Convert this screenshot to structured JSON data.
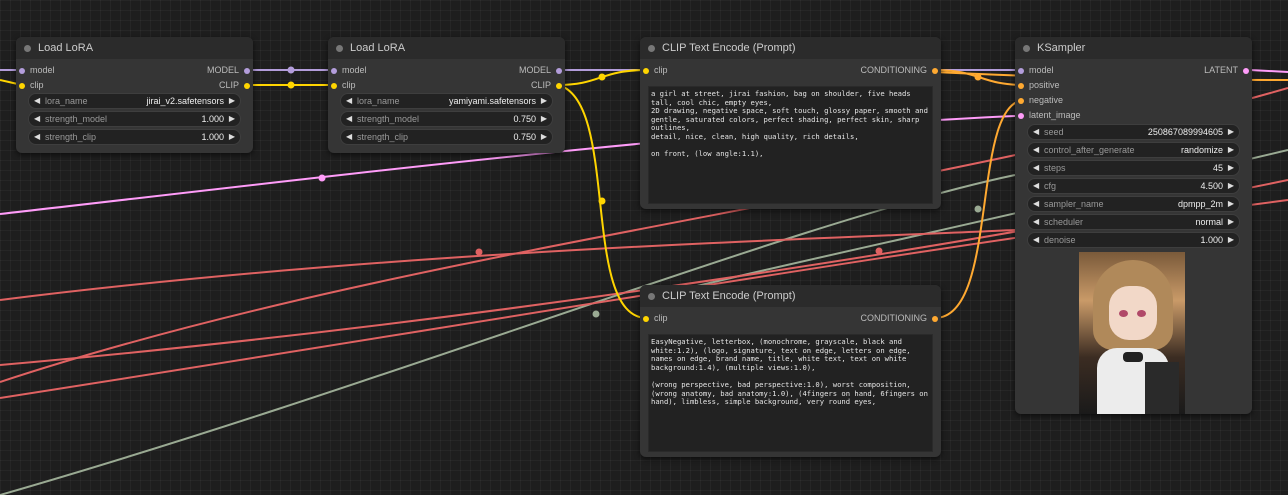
{
  "colors": {
    "model": "#b39ddb",
    "clip": "#ffd500",
    "conditioning": "#ffa931",
    "latent": "#ff9cf9",
    "red": "#e06262",
    "gray": "#9aaa93"
  },
  "nodes": {
    "lora1": {
      "title": "Load LoRA",
      "in_model": "model",
      "in_clip": "clip",
      "out_model": "MODEL",
      "out_clip": "CLIP",
      "w1_label": "lora_name",
      "w1_value": "jirai_v2.safetensors",
      "w2_label": "strength_model",
      "w2_value": "1.000",
      "w3_label": "strength_clip",
      "w3_value": "1.000"
    },
    "lora2": {
      "title": "Load LoRA",
      "in_model": "model",
      "in_clip": "clip",
      "out_model": "MODEL",
      "out_clip": "CLIP",
      "w1_label": "lora_name",
      "w1_value": "yamiyami.safetensors",
      "w2_label": "strength_model",
      "w2_value": "0.750",
      "w3_label": "strength_clip",
      "w3_value": "0.750"
    },
    "clip_pos": {
      "title": "CLIP Text Encode (Prompt)",
      "in_clip": "clip",
      "out": "CONDITIONING",
      "text": "a girl at street, jirai fashion, bag on shoulder, five heads tall, cool chic, empty eyes,\n2D drawing, negative space, soft touch, glossy paper, smooth and gentle, saturated colors, perfect shading, perfect skin, sharp outlines,\ndetail, nice, clean, high quality, rich details,\n\non front, (low angle:1.1),"
    },
    "clip_neg": {
      "title": "CLIP Text Encode (Prompt)",
      "in_clip": "clip",
      "out": "CONDITIONING",
      "text": "EasyNegative, letterbox, (monochrome, grayscale, black and white:1.2), (logo, signature, text on edge, letters on edge, names on edge, brand name, title, white text, text on white background:1.4), (multiple views:1.0),\n\n(wrong perspective, bad perspective:1.0), worst composition, (wrong anatomy, bad anatomy:1.0), (4fingers on hand, 6fingers on hand), limbless, simple background, very round eyes,"
    },
    "ksampler": {
      "title": "KSampler",
      "in_model": "model",
      "in_positive": "positive",
      "in_negative": "negative",
      "in_latent": "latent_image",
      "out": "LATENT",
      "widgets": [
        {
          "label": "seed",
          "value": "250867089994605"
        },
        {
          "label": "control_after_generate",
          "value": "randomize"
        },
        {
          "label": "steps",
          "value": "45"
        },
        {
          "label": "cfg",
          "value": "4.500"
        },
        {
          "label": "sampler_name",
          "value": "dpmpp_2m"
        },
        {
          "label": "scheduler",
          "value": "normal"
        },
        {
          "label": "denoise",
          "value": "1.000"
        }
      ]
    }
  }
}
